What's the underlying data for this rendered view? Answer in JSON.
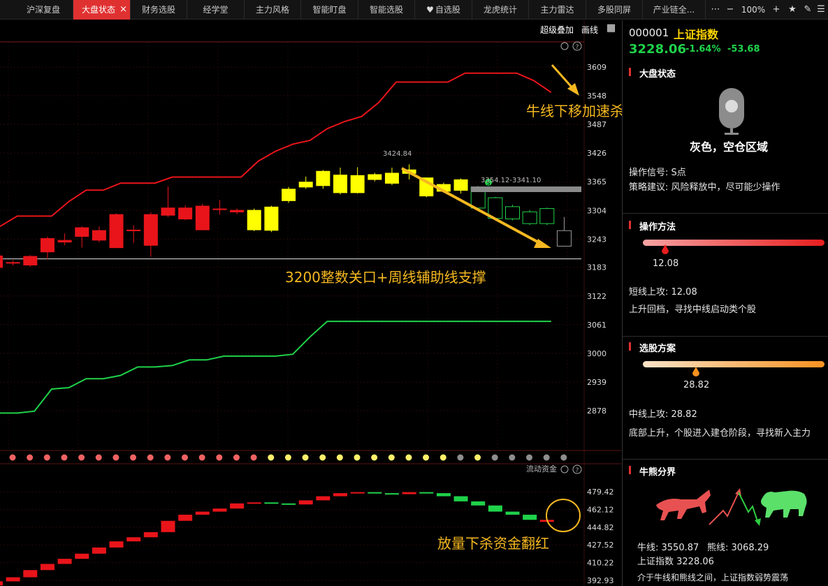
{
  "tabs": [
    {
      "label": "沪深复盘"
    },
    {
      "label": "大盘状态",
      "active": true
    },
    {
      "label": "财务选股"
    },
    {
      "label": "经学堂"
    },
    {
      "label": "主力风格"
    },
    {
      "label": "智能盯盘"
    },
    {
      "label": "智能选股"
    },
    {
      "label": "自选股"
    },
    {
      "label": "龙虎统计"
    },
    {
      "label": "主力雷达"
    },
    {
      "label": "多股同屏"
    },
    {
      "label": "产业链全..."
    }
  ],
  "window": {
    "zoom": "100%",
    "close_tab": "×"
  },
  "toolbar": {
    "overlay_label": "超级叠加",
    "draw_label": "画线"
  },
  "chart": {
    "price_axis": [
      "3609",
      "3548",
      "3487",
      "3426",
      "3365",
      "3304",
      "3243",
      "3183",
      "3122",
      "3061",
      "3000",
      "2939",
      "2878"
    ],
    "flow_axis": [
      "479.42",
      "462.12",
      "444.82",
      "427.52",
      "410.22",
      "392.93"
    ],
    "flow_label": "流动资金",
    "high_label": "3424.84",
    "gap_label": "3354.12-3341.10",
    "signal_mark": "S"
  },
  "annotations": {
    "bull_line": "牛线下移加速杀跌",
    "support": "3200整数关口+周线辅助线支撑",
    "flow": "放量下杀资金翻红"
  },
  "panel": {
    "code": "000001",
    "name": "上证指数",
    "price": "3228.06",
    "pct": "-1.64%",
    "change": "-53.68",
    "market_status": {
      "title": "大盘状态",
      "state": "灰色，空仓区域",
      "signal": "操作信号: S点",
      "advice": "策略建议: 风险释放中，尽可能少操作"
    },
    "operation": {
      "title": "操作方法",
      "value": "12.08",
      "line1": "短线上攻: 12.08",
      "line2": "上升回档，寻找中线启动类个股"
    },
    "selection": {
      "title": "选股方案",
      "value": "28.82",
      "line1": "中线上攻: 28.82",
      "line2": "底部上升，个股进入建仓阶段，寻找新入主力"
    },
    "bull_bear": {
      "title": "牛熊分界",
      "bull": "牛线: 3550.87",
      "bear": "熊线: 3068.29",
      "index": "上证指数  3228.06",
      "desc": "介于牛线和熊线之间，上证指数弱势震荡"
    }
  },
  "colors": {
    "up": "#e8141a",
    "yellow": "#ffff00",
    "down": "#1fd24a",
    "accent": "#e03131",
    "annotation": "#f5b820"
  },
  "chart_data": {
    "type": "candlestick",
    "ylim": [
      2850,
      3640
    ],
    "candles": [
      {
        "o": 3182,
        "c": 3208,
        "h": 3212,
        "l": 3180,
        "color": "red"
      },
      {
        "o": 3191,
        "c": 3194,
        "h": 3198,
        "l": 3187,
        "color": "red"
      },
      {
        "o": 3187,
        "c": 3207,
        "h": 3209,
        "l": 3184,
        "color": "red"
      },
      {
        "o": 3215,
        "c": 3245,
        "h": 3248,
        "l": 3200,
        "color": "red"
      },
      {
        "o": 3236,
        "c": 3241,
        "h": 3255,
        "l": 3230,
        "color": "red"
      },
      {
        "o": 3248,
        "c": 3268,
        "h": 3270,
        "l": 3225,
        "color": "red"
      },
      {
        "o": 3240,
        "c": 3262,
        "h": 3270,
        "l": 3236,
        "color": "red"
      },
      {
        "o": 3224,
        "c": 3296,
        "h": 3298,
        "l": 3224,
        "color": "red"
      },
      {
        "o": 3260,
        "c": 3263,
        "h": 3272,
        "l": 3235,
        "color": "red"
      },
      {
        "o": 3229,
        "c": 3296,
        "h": 3300,
        "l": 3206,
        "color": "red"
      },
      {
        "o": 3293,
        "c": 3310,
        "h": 3355,
        "l": 3290,
        "color": "red"
      },
      {
        "o": 3285,
        "c": 3310,
        "h": 3315,
        "l": 3283,
        "color": "red"
      },
      {
        "o": 3262,
        "c": 3314,
        "h": 3318,
        "l": 3262,
        "color": "red"
      },
      {
        "o": 3305,
        "c": 3308,
        "h": 3326,
        "l": 3295,
        "color": "red"
      },
      {
        "o": 3305,
        "c": 3300,
        "h": 3308,
        "l": 3296,
        "color": "red"
      },
      {
        "o": 3305,
        "c": 3262,
        "h": 3308,
        "l": 3260,
        "color": "yellow"
      },
      {
        "o": 3312,
        "c": 3261,
        "h": 3314,
        "l": 3258,
        "color": "yellow"
      },
      {
        "o": 3324,
        "c": 3350,
        "h": 3354,
        "l": 3320,
        "color": "yellow"
      },
      {
        "o": 3365,
        "c": 3353,
        "h": 3376,
        "l": 3350,
        "color": "yellow"
      },
      {
        "o": 3388,
        "c": 3356,
        "h": 3390,
        "l": 3350,
        "color": "yellow"
      },
      {
        "o": 3380,
        "c": 3341,
        "h": 3395,
        "l": 3338,
        "color": "yellow"
      },
      {
        "o": 3379,
        "c": 3341,
        "h": 3396,
        "l": 3340,
        "color": "yellow"
      },
      {
        "o": 3381,
        "c": 3369,
        "h": 3384,
        "l": 3366,
        "color": "yellow"
      },
      {
        "o": 3384,
        "c": 3361,
        "h": 3395,
        "l": 3358,
        "color": "yellow"
      },
      {
        "o": 3391,
        "c": 3382,
        "h": 3402,
        "l": 3370,
        "color": "yellow"
      },
      {
        "o": 3374,
        "c": 3334,
        "h": 3374,
        "l": 3332,
        "color": "yellow"
      },
      {
        "o": 3360,
        "c": 3344,
        "h": 3363,
        "l": 3342,
        "color": "yellow"
      },
      {
        "o": 3370,
        "c": 3346,
        "h": 3372,
        "l": 3340,
        "color": "yellow"
      },
      {
        "o": 3309,
        "c": 3354,
        "h": 3356,
        "l": 3305,
        "color": "green"
      },
      {
        "o": 3287,
        "c": 3331,
        "h": 3333,
        "l": 3285,
        "color": "green"
      },
      {
        "o": 3286,
        "c": 3312,
        "h": 3316,
        "l": 3283,
        "color": "green"
      },
      {
        "o": 3276,
        "c": 3301,
        "h": 3305,
        "l": 3273,
        "color": "green"
      },
      {
        "o": 3276,
        "c": 3308,
        "h": 3310,
        "l": 3273,
        "color": "green"
      },
      {
        "o": 3228,
        "c": 3261,
        "h": 3290,
        "l": 3227,
        "color": "green"
      }
    ],
    "bull_line": [
      3270,
      3292,
      3292,
      3292,
      3323,
      3347,
      3347,
      3362,
      3362,
      3362,
      3375,
      3375,
      3375,
      3375,
      3375,
      3409,
      3430,
      3445,
      3453,
      3478,
      3493,
      3504,
      3534,
      3577,
      3577,
      3577,
      3577,
      3596,
      3596,
      3596,
      3596,
      3580,
      3555
    ],
    "bear_line": [
      2873,
      2873,
      2877,
      2924,
      2927,
      2946,
      2946,
      2953,
      2971,
      2971,
      2974,
      2986,
      2986,
      2994,
      2994,
      2994,
      2994,
      2998,
      3035,
      3068,
      3068,
      3068,
      3068,
      3068,
      3068,
      3068,
      3068,
      3068,
      3068,
      3068,
      3068,
      3068,
      3068
    ],
    "support_level": 3201,
    "flow": [
      392,
      396,
      403,
      409,
      414,
      419,
      425,
      431,
      435,
      440,
      451,
      457,
      460,
      463,
      468,
      469,
      468,
      467,
      471,
      475,
      478,
      479,
      478,
      477,
      479,
      478,
      475,
      470,
      466,
      460,
      457,
      452,
      450
    ]
  }
}
